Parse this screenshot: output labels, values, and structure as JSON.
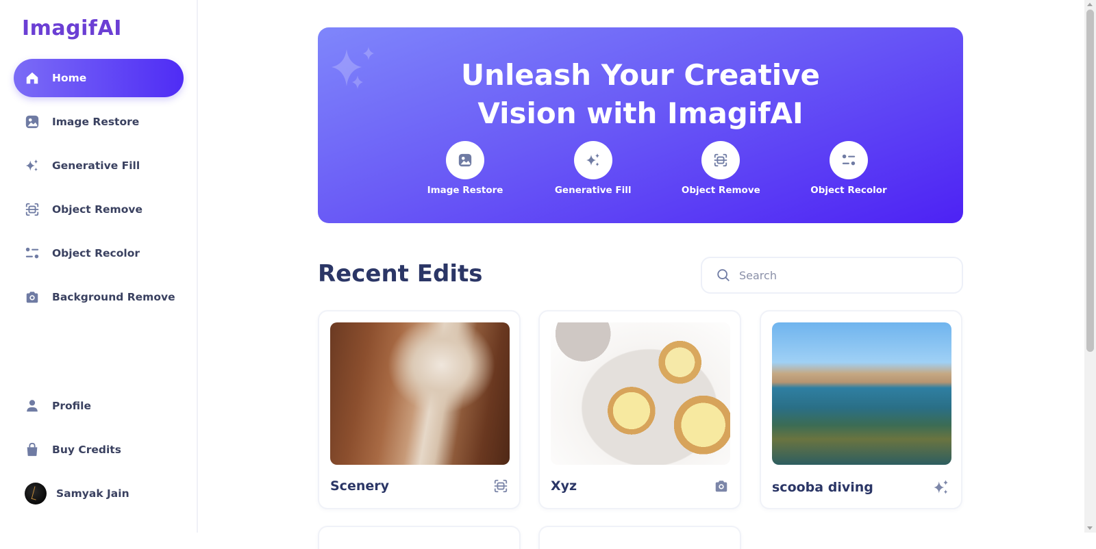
{
  "app": {
    "logo": "ImagifAI"
  },
  "sidebar": {
    "items": [
      {
        "label": "Home",
        "icon": "home-icon",
        "active": true
      },
      {
        "label": "Image Restore",
        "icon": "image-icon"
      },
      {
        "label": "Generative Fill",
        "icon": "sparkles-icon"
      },
      {
        "label": "Object Remove",
        "icon": "scan-icon"
      },
      {
        "label": "Object Recolor",
        "icon": "filter-icon"
      },
      {
        "label": "Background Remove",
        "icon": "camera-icon"
      }
    ],
    "bottom": [
      {
        "label": "Profile",
        "icon": "user-icon"
      },
      {
        "label": "Buy Credits",
        "icon": "bag-icon"
      }
    ],
    "user": {
      "name": "Samyak Jain"
    }
  },
  "hero": {
    "title_line1": "Unleash Your Creative",
    "title_line2": "Vision with ImagifAI",
    "actions": [
      {
        "label": "Image Restore",
        "icon": "image-icon"
      },
      {
        "label": "Generative Fill",
        "icon": "sparkles-icon"
      },
      {
        "label": "Object Remove",
        "icon": "scan-icon"
      },
      {
        "label": "Object Recolor",
        "icon": "filter-icon"
      }
    ]
  },
  "recent": {
    "title": "Recent Edits",
    "search_placeholder": "Search",
    "cards": [
      {
        "name": "Scenery",
        "icon": "scan-icon"
      },
      {
        "name": "Xyz",
        "icon": "camera-icon"
      },
      {
        "name": "scooba diving",
        "icon": "sparkles-icon"
      }
    ]
  },
  "colors": {
    "accent": "#5b3ff5",
    "logo": "#6b3fd4",
    "heading": "#2b3666",
    "icon": "#7c86a8"
  }
}
